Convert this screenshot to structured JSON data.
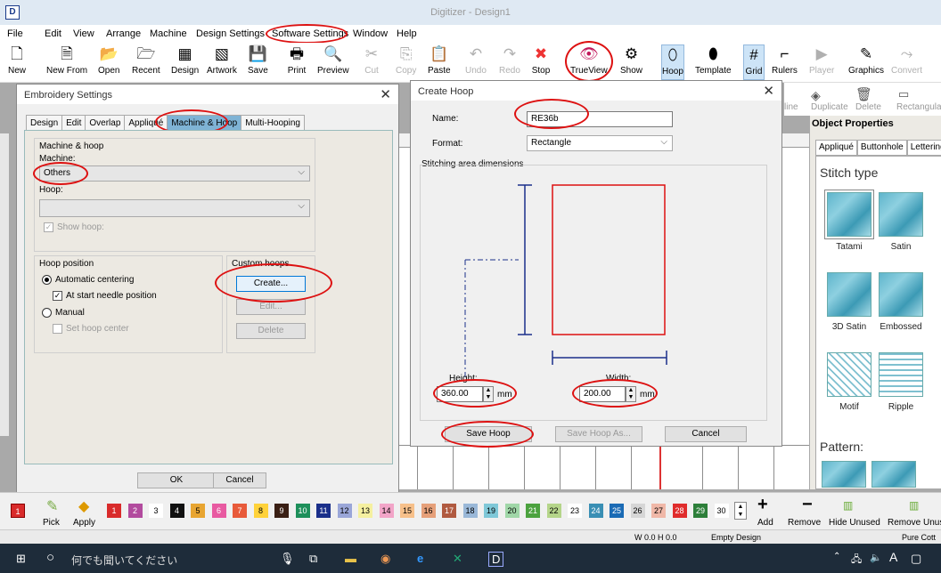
{
  "app": {
    "title": "Digitizer - Design1"
  },
  "menu": [
    "File",
    "Edit",
    "View",
    "Arrange",
    "Machine",
    "Design Settings",
    "Software Settings",
    "Window",
    "Help"
  ],
  "ribbon": [
    {
      "label": "New",
      "icon": "new-file-icon",
      "glyph": "🗋"
    },
    {
      "label": "New From",
      "icon": "new-from-icon",
      "glyph": "🗎"
    },
    {
      "label": "Open",
      "icon": "open-folder-icon",
      "glyph": "📂"
    },
    {
      "label": "Recent",
      "icon": "recent-folder-icon",
      "glyph": "🗁"
    },
    {
      "label": "Design",
      "icon": "design-icon",
      "glyph": "▦"
    },
    {
      "label": "Artwork",
      "icon": "artwork-icon",
      "glyph": "▧"
    },
    {
      "label": "Save",
      "icon": "save-icon",
      "glyph": "💾"
    },
    {
      "label": "Print",
      "icon": "print-icon",
      "glyph": "🖶"
    },
    {
      "label": "Preview",
      "icon": "preview-icon",
      "glyph": "🔍"
    },
    {
      "label": "Cut",
      "icon": "cut-icon",
      "glyph": "✂"
    },
    {
      "label": "Copy",
      "icon": "copy-icon",
      "glyph": "⎘"
    },
    {
      "label": "Paste",
      "icon": "paste-icon",
      "glyph": "📋"
    },
    {
      "label": "Undo",
      "icon": "undo-icon",
      "glyph": "↶"
    },
    {
      "label": "Redo",
      "icon": "redo-icon",
      "glyph": "↷"
    },
    {
      "label": "Stop",
      "icon": "stop-icon",
      "glyph": "✖"
    },
    {
      "label": "TrueView",
      "icon": "trueview-icon",
      "glyph": "👁"
    },
    {
      "label": "Show",
      "icon": "show-icon",
      "glyph": "⚙"
    },
    {
      "label": "Hoop",
      "icon": "hoop-icon",
      "glyph": "⬯"
    },
    {
      "label": "Template",
      "icon": "template-icon",
      "glyph": "⬮"
    },
    {
      "label": "Grid",
      "icon": "grid-icon",
      "glyph": "#"
    },
    {
      "label": "Rulers",
      "icon": "rulers-icon",
      "glyph": "⌐"
    },
    {
      "label": "Player",
      "icon": "player-icon",
      "glyph": "▶"
    },
    {
      "label": "Graphics",
      "icon": "graphics-icon",
      "glyph": "✎"
    },
    {
      "label": "Convert",
      "icon": "convert-icon",
      "glyph": "⤳"
    }
  ],
  "row2": {
    "duplicate": "Duplicate",
    "delete": "Delete",
    "rectangle": "Rectangula",
    "line": "line"
  },
  "embroidery": {
    "title": "Embroidery Settings",
    "tabs": [
      "Design",
      "Edit",
      "Overlap",
      "Appliqué",
      "Machine & Hoop",
      "Multi-Hooping"
    ],
    "group_machine": "Machine & hoop",
    "machine_label": "Machine:",
    "machine_value": "Others",
    "hoop_label": "Hoop:",
    "show_hoop": "Show hoop:",
    "group_position": "Hoop position",
    "auto_centering": "Automatic centering",
    "start_needle": "At start needle position",
    "manual": "Manual",
    "set_center": "Set hoop center",
    "group_custom": "Custom hoops",
    "create": "Create...",
    "edit": "Edit...",
    "delete": "Delete",
    "ok": "OK",
    "cancel": "Cancel"
  },
  "create_hoop": {
    "title": "Create Hoop",
    "name_label": "Name:",
    "name_value": "RE36b",
    "format_label": "Format:",
    "format_value": "Rectangle",
    "area_label": "Stitching area dimensions",
    "height_label": "Height:",
    "height_value": "360.00",
    "width_label": "Width:",
    "width_value": "200.00",
    "unit": "mm",
    "save": "Save Hoop",
    "save_as": "Save Hoop As...",
    "cancel": "Cancel"
  },
  "obj_props": {
    "title": "Object Properties",
    "tabs": [
      "Appliqué",
      "Buttonhole",
      "Lettering"
    ],
    "stitch_type": "Stitch type",
    "types": [
      "Tatami",
      "Satin",
      "3D Satin",
      "Embossed",
      "Motif",
      "Ripple"
    ],
    "pattern": "Pattern:"
  },
  "colorbar": {
    "pick": "Pick",
    "apply": "Apply",
    "add": "Add",
    "remove": "Remove",
    "hide_unused": "Hide Unused",
    "remove_unused": "Remove Unus",
    "chips": [
      {
        "n": "1",
        "c": "#d92b2b"
      },
      {
        "n": "2",
        "c": "#b24b9e"
      },
      {
        "n": "3",
        "c": "#ffffff"
      },
      {
        "n": "4",
        "c": "#111111"
      },
      {
        "n": "5",
        "c": "#e8a531"
      },
      {
        "n": "6",
        "c": "#e85aa1"
      },
      {
        "n": "7",
        "c": "#e85a3a"
      },
      {
        "n": "8",
        "c": "#ffd23a"
      },
      {
        "n": "9",
        "c": "#3a1f14"
      },
      {
        "n": "10",
        "c": "#1d8f5a"
      },
      {
        "n": "11",
        "c": "#1a2f8a"
      },
      {
        "n": "12",
        "c": "#9aa6d8"
      },
      {
        "n": "13",
        "c": "#f5f0a0"
      },
      {
        "n": "14",
        "c": "#f2a5c8"
      },
      {
        "n": "15",
        "c": "#f7c08a"
      },
      {
        "n": "16",
        "c": "#e6a07a"
      },
      {
        "n": "17",
        "c": "#b05a40"
      },
      {
        "n": "18",
        "c": "#9ab8d8"
      },
      {
        "n": "19",
        "c": "#7fc8d8"
      },
      {
        "n": "20",
        "c": "#a0d7a8"
      },
      {
        "n": "21",
        "c": "#4ca23f"
      },
      {
        "n": "22",
        "c": "#b5d58a"
      },
      {
        "n": "23",
        "c": "#ffffff"
      },
      {
        "n": "24",
        "c": "#3a8fb4"
      },
      {
        "n": "25",
        "c": "#1b6bb5"
      },
      {
        "n": "26",
        "c": "#d6d6d6"
      },
      {
        "n": "27",
        "c": "#f0b8a8"
      },
      {
        "n": "28",
        "c": "#e02c2c"
      },
      {
        "n": "29",
        "c": "#2d7f3a"
      },
      {
        "n": "30",
        "c": "#ffffff"
      }
    ]
  },
  "status": {
    "coords": "W  0.0 H  0.0",
    "design": "Empty Design",
    "thread": "Pure Cott"
  },
  "taskbar": {
    "search": "何でも聞いてください",
    "ime": "A"
  }
}
